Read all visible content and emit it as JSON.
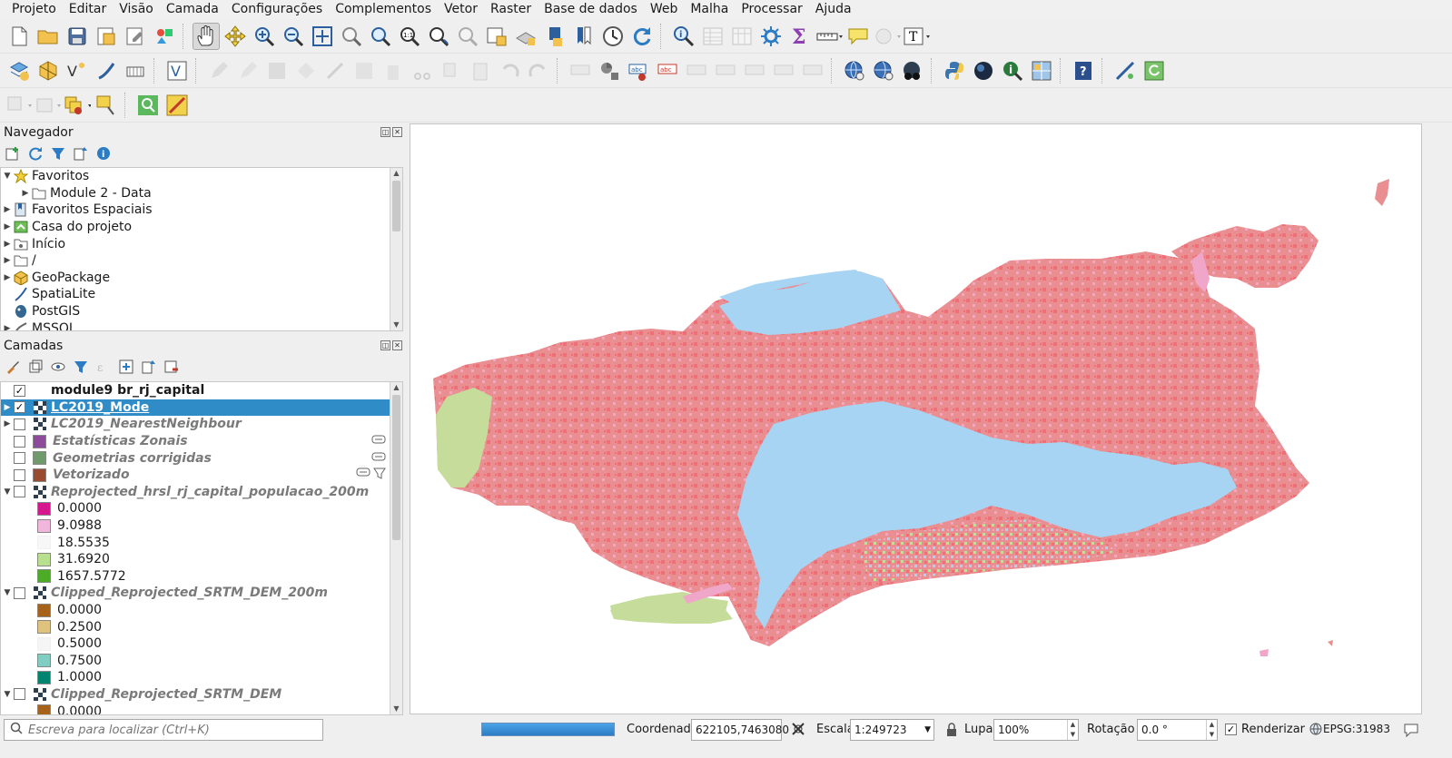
{
  "menu": [
    "Projeto",
    "Editar",
    "Visão",
    "Camada",
    "Configurações",
    "Complementos",
    "Vetor",
    "Raster",
    "Base de dados",
    "Web",
    "Malha",
    "Processar",
    "Ajuda"
  ],
  "navigator": {
    "title": "Navegador",
    "items": [
      {
        "label": "Favoritos",
        "icon": "star-icon"
      },
      {
        "label": "Module 2 - Data",
        "icon": "folder-icon"
      },
      {
        "label": "Favoritos Espaciais",
        "icon": "spatial-bookmarks-icon"
      },
      {
        "label": "Casa do projeto",
        "icon": "project-home-icon"
      },
      {
        "label": "Início",
        "icon": "home-folder-icon"
      },
      {
        "label": "/",
        "icon": "folder-icon"
      },
      {
        "label": "GeoPackage",
        "icon": "geopackage-icon"
      },
      {
        "label": "SpatiaLite",
        "icon": "spatialite-icon"
      },
      {
        "label": "PostGIS",
        "icon": "postgis-icon"
      },
      {
        "label": "MSSQL",
        "icon": "mssql-icon"
      }
    ]
  },
  "layers": {
    "title": "Camadas",
    "items": [
      {
        "label": "module9 br_rj_capital"
      },
      {
        "label": "LC2019_Mode"
      },
      {
        "label": "LC2019_NearestNeighbour"
      },
      {
        "label": "Estatísticas Zonais",
        "color": "#8e4b9c"
      },
      {
        "label": "Geometrias corrigidas",
        "color": "#6f9b6b"
      },
      {
        "label": "Vetorizado",
        "color": "#9a4a2e"
      },
      {
        "label": "Reprojected_hrsl_rj_capital_populacao_200m"
      },
      {
        "label": "Clipped_Reprojected_SRTM_DEM_200m"
      },
      {
        "label": "Clipped_Reprojected_SRTM_DEM"
      }
    ],
    "legend_population": [
      {
        "value": "0.0000",
        "color": "#d6188f"
      },
      {
        "value": "9.0988",
        "color": "#f0b6dc"
      },
      {
        "value": "18.5535",
        "color": "#f7f7f7"
      },
      {
        "value": "31.6920",
        "color": "#b9e08f"
      },
      {
        "value": "1657.5772",
        "color": "#4dac26"
      }
    ],
    "legend_dem_200m": [
      {
        "value": "0.0000",
        "color": "#a6611a"
      },
      {
        "value": "0.2500",
        "color": "#dfc27d"
      },
      {
        "value": "0.5000",
        "color": "#f5f5f5"
      },
      {
        "value": "0.7500",
        "color": "#80cdc1"
      },
      {
        "value": "1.0000",
        "color": "#018571"
      }
    ],
    "legend_dem": [
      {
        "value": "0.0000",
        "color": "#a6611a"
      }
    ]
  },
  "map_colors": {
    "urban": "#e98f92",
    "dense": "#ee6f78",
    "water": "#a7d4f2",
    "grass": "#c5dc9b",
    "pink": "#f0a6c9"
  },
  "status": {
    "locator_placeholder": "Escreva para localizar (Ctrl+K)",
    "coord_label": "Coordenada",
    "coord_value": "622105,7463080",
    "scale_label": "Escala",
    "scale_value": "1:249723",
    "magnifier_label": "Lupa",
    "magnifier_value": "100%",
    "rotation_label": "Rotação",
    "rotation_value": "0.0 °",
    "render_label": "Renderizar",
    "crs": "EPSG:31983"
  }
}
